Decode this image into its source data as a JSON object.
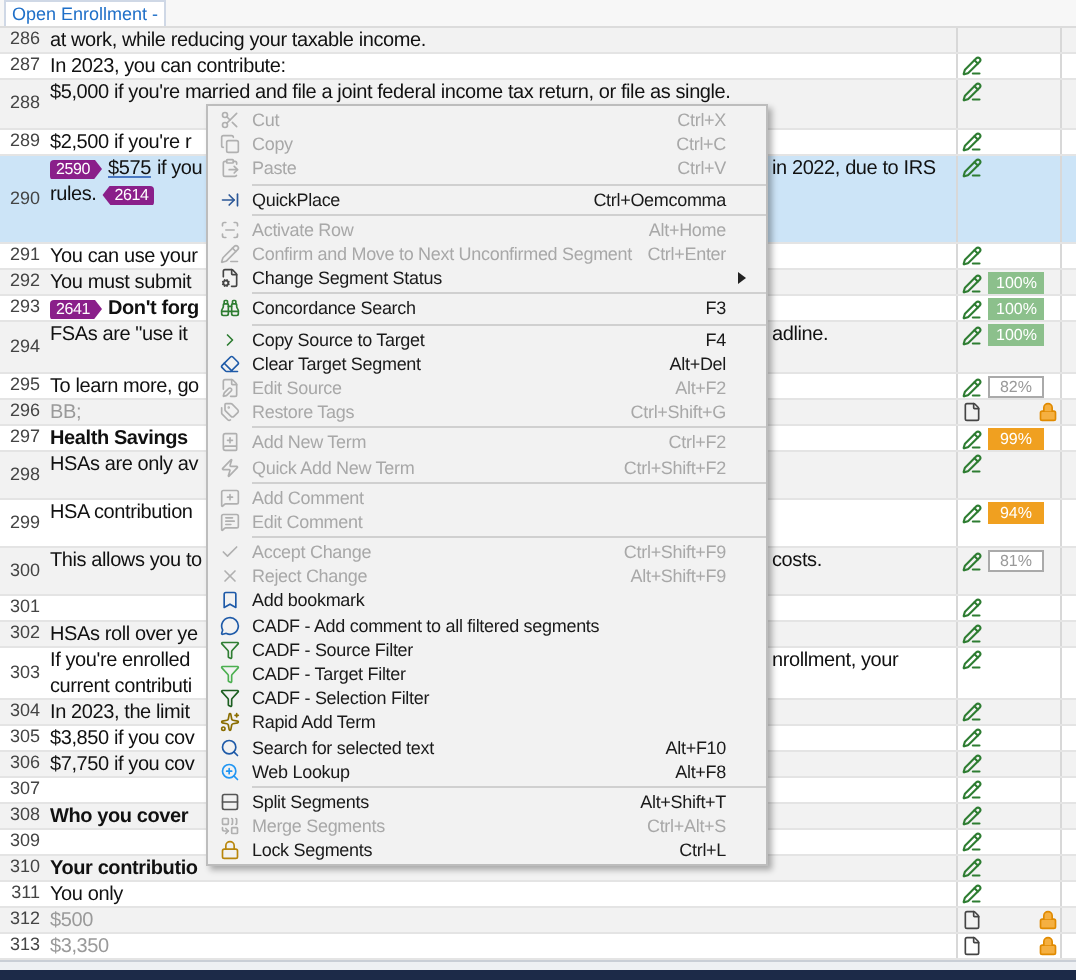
{
  "document_tab": {
    "title": "Open Enrollment -"
  },
  "rows": [
    {
      "number": "286",
      "kind": "body",
      "selected": false,
      "lines": [
        {
          "left": [
            {
              "kind": "text",
              "text": "at work, while reducing your taxable income."
            }
          ]
        }
      ],
      "status": null
    },
    {
      "number": "287",
      "kind": "body",
      "selected": false,
      "lines": [
        {
          "left": [
            {
              "kind": "text",
              "text": "In 2023, you can contribute:"
            }
          ]
        }
      ],
      "status": {
        "kind": "edited"
      }
    },
    {
      "number": "288",
      "kind": "body",
      "selected": false,
      "lines": [
        {
          "left": [
            {
              "kind": "text",
              "text": "$5,000 if you're married and file a joint federal income tax return, or file as single."
            }
          ]
        }
      ],
      "status": {
        "kind": "edited"
      }
    },
    {
      "number": "289",
      "kind": "body",
      "selected": false,
      "lines": [
        {
          "left": [
            {
              "kind": "text",
              "text": "$2,500 if you're r"
            }
          ]
        }
      ],
      "status": {
        "kind": "edited"
      }
    },
    {
      "number": "290",
      "kind": "body",
      "selected": true,
      "lines": [
        {
          "left": [
            {
              "kind": "tag_open",
              "text": "2590"
            },
            {
              "kind": "link",
              "text": "$575"
            },
            {
              "kind": "text",
              "text": "if you"
            }
          ],
          "right": "in 2022, due to IRS"
        },
        {
          "left": [
            {
              "kind": "text",
              "text": "rules."
            },
            {
              "kind": "tag_close",
              "text": "2614"
            }
          ]
        }
      ],
      "status": {
        "kind": "edited"
      }
    },
    {
      "number": "291",
      "kind": "body",
      "selected": false,
      "lines": [
        {
          "left": [
            {
              "kind": "text",
              "text": "You can use your"
            }
          ]
        }
      ],
      "status": {
        "kind": "edited"
      }
    },
    {
      "number": "292",
      "kind": "body",
      "selected": false,
      "lines": [
        {
          "left": [
            {
              "kind": "text",
              "text": "You must submit"
            }
          ]
        }
      ],
      "status": {
        "kind": "edited",
        "match": {
          "text": "100%",
          "kind": "exact"
        }
      }
    },
    {
      "number": "293",
      "kind": "heading",
      "selected": false,
      "lines": [
        {
          "left": [
            {
              "kind": "tag_open",
              "text": "2641"
            },
            {
              "kind": "text",
              "text": "Don't forg"
            }
          ]
        }
      ],
      "status": {
        "kind": "edited",
        "match": {
          "text": "100%",
          "kind": "exact"
        }
      }
    },
    {
      "number": "294",
      "kind": "body",
      "selected": false,
      "lines": [
        {
          "left": [
            {
              "kind": "text",
              "text": "FSAs are \"use it"
            }
          ],
          "right": "adline."
        }
      ],
      "status": {
        "kind": "edited",
        "match": {
          "text": "100%",
          "kind": "exact"
        }
      }
    },
    {
      "number": "295",
      "kind": "body",
      "selected": false,
      "lines": [
        {
          "left": [
            {
              "kind": "text",
              "text": "To learn more, go"
            }
          ]
        }
      ],
      "status": {
        "kind": "edited",
        "match": {
          "text": "82%",
          "kind": "low"
        }
      }
    },
    {
      "number": "296",
      "kind": "locked",
      "selected": false,
      "lines": [
        {
          "left": [
            {
              "kind": "text",
              "text": "BB;"
            }
          ]
        }
      ],
      "status": {
        "kind": "locked"
      }
    },
    {
      "number": "297",
      "kind": "heading",
      "selected": false,
      "lines": [
        {
          "left": [
            {
              "kind": "text",
              "text": "Health Savings"
            }
          ]
        }
      ],
      "status": {
        "kind": "edited",
        "match": {
          "text": "99%",
          "kind": "high"
        }
      }
    },
    {
      "number": "298",
      "kind": "body",
      "selected": false,
      "lines": [
        {
          "left": [
            {
              "kind": "text",
              "text": "HSAs are only av"
            }
          ]
        }
      ],
      "status": {
        "kind": "edited"
      }
    },
    {
      "number": "299",
      "kind": "body",
      "selected": false,
      "lines": [
        {
          "left": [
            {
              "kind": "text",
              "text": "HSA contribution"
            }
          ]
        }
      ],
      "status": {
        "kind": "edited",
        "match": {
          "text": "94%",
          "kind": "high"
        }
      }
    },
    {
      "number": "300",
      "kind": "body",
      "selected": false,
      "lines": [
        {
          "left": [
            {
              "kind": "text",
              "text": "This allows you to"
            }
          ],
          "right": "costs."
        }
      ],
      "status": {
        "kind": "edited",
        "match": {
          "text": "81%",
          "kind": "low"
        }
      }
    },
    {
      "number": "301",
      "kind": "body",
      "selected": false,
      "lines": [],
      "status": {
        "kind": "edited"
      }
    },
    {
      "number": "302",
      "kind": "body",
      "selected": false,
      "lines": [
        {
          "left": [
            {
              "kind": "text",
              "text": "HSAs roll over ye"
            }
          ]
        }
      ],
      "status": {
        "kind": "edited"
      }
    },
    {
      "number": "303",
      "kind": "body",
      "selected": false,
      "lines": [
        {
          "left": [
            {
              "kind": "text",
              "text": "If you're enrolled"
            }
          ],
          "right": "nrollment, your"
        },
        {
          "left": [
            {
              "kind": "text",
              "text": "current contributi"
            }
          ]
        }
      ],
      "status": {
        "kind": "edited"
      }
    },
    {
      "number": "304",
      "kind": "body",
      "selected": false,
      "lines": [
        {
          "left": [
            {
              "kind": "text",
              "text": "In 2023, the limit"
            }
          ]
        }
      ],
      "status": {
        "kind": "edited"
      }
    },
    {
      "number": "305",
      "kind": "body",
      "selected": false,
      "lines": [
        {
          "left": [
            {
              "kind": "text",
              "text": "$3,850 if you cov"
            }
          ]
        }
      ],
      "status": {
        "kind": "edited"
      }
    },
    {
      "number": "306",
      "kind": "body",
      "selected": false,
      "lines": [
        {
          "left": [
            {
              "kind": "text",
              "text": "$7,750 if you cov"
            }
          ]
        }
      ],
      "status": {
        "kind": "edited"
      }
    },
    {
      "number": "307",
      "kind": "body",
      "selected": false,
      "lines": [],
      "status": {
        "kind": "edited"
      }
    },
    {
      "number": "308",
      "kind": "heading",
      "selected": false,
      "lines": [
        {
          "left": [
            {
              "kind": "text",
              "text": "Who you cover"
            }
          ]
        }
      ],
      "status": {
        "kind": "edited"
      }
    },
    {
      "number": "309",
      "kind": "body",
      "selected": false,
      "lines": [],
      "status": {
        "kind": "edited"
      }
    },
    {
      "number": "310",
      "kind": "heading",
      "selected": false,
      "lines": [
        {
          "left": [
            {
              "kind": "text",
              "text": "Your contributio"
            }
          ]
        }
      ],
      "status": {
        "kind": "edited"
      }
    },
    {
      "number": "311",
      "kind": "body",
      "selected": false,
      "lines": [
        {
          "left": [
            {
              "kind": "text",
              "text": "You only"
            }
          ]
        }
      ],
      "status": {
        "kind": "edited"
      }
    },
    {
      "number": "312",
      "kind": "locked",
      "selected": false,
      "lines": [
        {
          "left": [
            {
              "kind": "text",
              "text": "$500"
            }
          ]
        }
      ],
      "status": {
        "kind": "locked"
      }
    },
    {
      "number": "313",
      "kind": "locked",
      "selected": false,
      "lines": [
        {
          "left": [
            {
              "kind": "text",
              "text": "$3,350"
            }
          ]
        }
      ],
      "status": {
        "kind": "locked"
      }
    }
  ],
  "context_menu": {
    "items": [
      {
        "kind": "item",
        "label": "Cut",
        "shortcut": "Ctrl+X",
        "disabled": true
      },
      {
        "kind": "item",
        "label": "Copy",
        "shortcut": "Ctrl+C",
        "disabled": true
      },
      {
        "kind": "item",
        "label": "Paste",
        "shortcut": "Ctrl+V",
        "disabled": true
      },
      {
        "kind": "separator"
      },
      {
        "kind": "item",
        "label": "QuickPlace",
        "shortcut": "Ctrl+Oemcomma",
        "disabled": false
      },
      {
        "kind": "separator"
      },
      {
        "kind": "item",
        "label": "Activate Row",
        "shortcut": "Alt+Home",
        "disabled": true
      },
      {
        "kind": "item",
        "label": "Confirm and Move to Next Unconfirmed Segment",
        "shortcut": "Ctrl+Enter",
        "disabled": true
      },
      {
        "kind": "item",
        "label": "Change Segment Status",
        "disabled": false,
        "submenu": true
      },
      {
        "kind": "separator"
      },
      {
        "kind": "item",
        "label": "Concordance Search",
        "shortcut": "F3",
        "disabled": false
      },
      {
        "kind": "separator"
      },
      {
        "kind": "item",
        "label": "Copy Source to Target",
        "shortcut": "F4",
        "disabled": false
      },
      {
        "kind": "item",
        "label": "Clear Target Segment",
        "shortcut": "Alt+Del",
        "disabled": false
      },
      {
        "kind": "item",
        "label": "Edit Source",
        "shortcut": "Alt+F2",
        "disabled": true
      },
      {
        "kind": "item",
        "label": "Restore Tags",
        "shortcut": "Ctrl+Shift+G",
        "disabled": true
      },
      {
        "kind": "separator"
      },
      {
        "kind": "item",
        "label": "Add New Term",
        "shortcut": "Ctrl+F2",
        "disabled": true
      },
      {
        "kind": "item",
        "label": "Quick Add New Term",
        "shortcut": "Ctrl+Shift+F2",
        "disabled": true
      },
      {
        "kind": "separator"
      },
      {
        "kind": "item",
        "label": "Add Comment",
        "disabled": true
      },
      {
        "kind": "item",
        "label": "Edit Comment",
        "disabled": true
      },
      {
        "kind": "separator"
      },
      {
        "kind": "item",
        "label": "Accept Change",
        "shortcut": "Ctrl+Shift+F9",
        "disabled": true
      },
      {
        "kind": "item",
        "label": "Reject Change",
        "shortcut": "Alt+Shift+F9",
        "disabled": true
      },
      {
        "kind": "item",
        "label": "Add bookmark",
        "disabled": false
      },
      {
        "kind": "item",
        "label": "CADF - Add comment to all filtered segments",
        "disabled": false
      },
      {
        "kind": "item",
        "label": "CADF - Source Filter",
        "disabled": false
      },
      {
        "kind": "item",
        "label": "CADF - Target Filter",
        "disabled": false
      },
      {
        "kind": "item",
        "label": "CADF - Selection Filter",
        "disabled": false
      },
      {
        "kind": "item",
        "label": "Rapid Add Term",
        "disabled": false
      },
      {
        "kind": "item",
        "label": "Search for selected text",
        "shortcut": "Alt+F10",
        "disabled": false
      },
      {
        "kind": "item",
        "label": "Web Lookup",
        "shortcut": "Alt+F8",
        "disabled": false
      },
      {
        "kind": "separator"
      },
      {
        "kind": "item",
        "label": "Split Segments",
        "shortcut": "Alt+Shift+T",
        "disabled": false
      },
      {
        "kind": "item",
        "label": "Merge Segments",
        "shortcut": "Ctrl+Alt+S",
        "disabled": true
      },
      {
        "kind": "item",
        "label": "Lock Segments",
        "shortcut": "Ctrl+L",
        "disabled": false
      }
    ]
  }
}
